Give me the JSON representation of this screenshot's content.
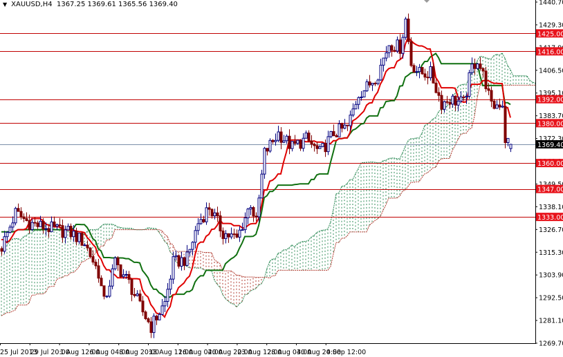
{
  "header": {
    "symbol": "XAUUSD,H4",
    "ohlc": "1367.25 1369.61 1365.56 1369.40",
    "menu_icon": "triangle-down-icon"
  },
  "colors": {
    "background": "#ffffff",
    "bull": "#000080",
    "bear": "#800000",
    "tenkan": "#e00000",
    "kijun": "#107010",
    "span_a": "#2e8b57",
    "span_b": "#b03a2e",
    "level_line": "#c00000",
    "level_label_bg": "#e8141c",
    "price_line": "#7b8fa8",
    "price_label_bg": "#000000"
  },
  "chart_data": {
    "type": "candlestick",
    "title": "XAUUSD,H4",
    "indicator": "Ichimoku Kinko Hyo",
    "ylim": [
      1269.7,
      1440.7
    ],
    "y_ticks": [
      "1440.70",
      "1429.30",
      "1417.90",
      "1406.50",
      "1395.10",
      "1383.70",
      "1372.30",
      "1360.90",
      "1349.50",
      "1338.10",
      "1326.70",
      "1315.30",
      "1303.90",
      "1292.50",
      "1281.10",
      "1269.70"
    ],
    "x_ticks": [
      "25 Jul 2013",
      "29 Jul 20:00",
      "1 Aug 12:00",
      "6 Aug 04:00",
      "8 Aug 20:00",
      "13 Aug 12:00",
      "16 Aug 04:00",
      "20 Aug 20:00",
      "23 Aug 12:00",
      "28 Aug 04:00",
      "30 Aug 20:00",
      "4 Sep 12:00"
    ],
    "levels": [
      "1425.00",
      "1416.00",
      "1392.00",
      "1380.00",
      "1360.00",
      "1347.00",
      "1333.00"
    ],
    "current_price": "1369.40",
    "close_path_approx": [
      [
        -80,
        1225
      ],
      [
        -60,
        1260
      ],
      [
        -45,
        1290
      ],
      [
        -30,
        1335
      ],
      [
        -15,
        1330
      ],
      [
        0,
        1318
      ],
      [
        5,
        1335
      ],
      [
        10,
        1330
      ],
      [
        15,
        1328
      ],
      [
        25,
        1325
      ],
      [
        30,
        1320
      ],
      [
        35,
        1305
      ],
      [
        37,
        1290
      ],
      [
        41,
        1310
      ],
      [
        46,
        1300
      ],
      [
        50,
        1288
      ],
      [
        54,
        1278
      ],
      [
        59,
        1290
      ],
      [
        62,
        1310
      ],
      [
        67,
        1312
      ],
      [
        71,
        1330
      ],
      [
        75,
        1338
      ],
      [
        80,
        1325
      ],
      [
        85,
        1322
      ],
      [
        90,
        1340
      ],
      [
        92,
        1330
      ],
      [
        95,
        1365
      ],
      [
        100,
        1375
      ],
      [
        105,
        1368
      ],
      [
        110,
        1372
      ],
      [
        115,
        1365
      ],
      [
        120,
        1375
      ],
      [
        125,
        1378
      ],
      [
        129,
        1395
      ],
      [
        132,
        1398
      ],
      [
        136,
        1405
      ],
      [
        140,
        1420
      ],
      [
        144,
        1418
      ],
      [
        146,
        1432
      ],
      [
        148,
        1410
      ],
      [
        151,
        1405
      ],
      [
        155,
        1405
      ],
      [
        159,
        1390
      ],
      [
        162,
        1392
      ],
      [
        167,
        1390
      ],
      [
        170,
        1408
      ],
      [
        172,
        1412
      ],
      [
        175,
        1400
      ],
      [
        177,
        1388
      ],
      [
        180,
        1390
      ],
      [
        181,
        1390
      ],
      [
        182,
        1372
      ],
      [
        184,
        1369.4
      ]
    ]
  }
}
